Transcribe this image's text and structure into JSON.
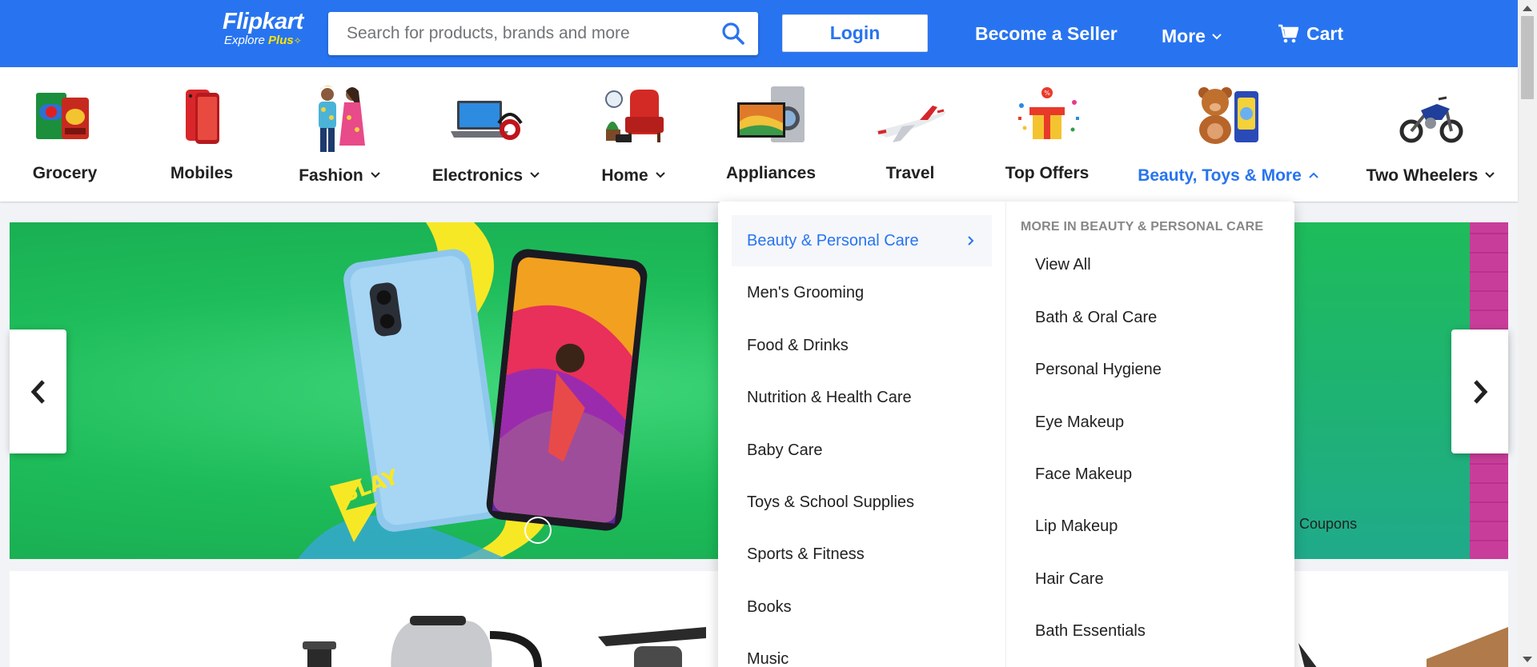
{
  "colors": {
    "brand": "#2874f0",
    "accent_yellow": "#ffe500",
    "banner_green": "#1ebc5a"
  },
  "header": {
    "logo_main": "Flipkart",
    "logo_sub_text": "Explore",
    "logo_sub_plus": "Plus",
    "search_placeholder": "Search for products, brands and more",
    "search_icon": "search-icon",
    "login_label": "Login",
    "seller_label": "Become a Seller",
    "more_label": "More",
    "cart_label": "Cart"
  },
  "categories": [
    {
      "label": "Grocery",
      "icon": "grocery-icon"
    },
    {
      "label": "Mobiles",
      "icon": "mobile-phone-icon"
    },
    {
      "label": "Fashion",
      "icon": "fashion-icon"
    },
    {
      "label": "Electronics",
      "icon": "laptop-icon"
    },
    {
      "label": "Home",
      "icon": "home-furniture-icon"
    },
    {
      "label": "Appliances",
      "icon": "appliances-icon"
    },
    {
      "label": "Travel",
      "icon": "airplane-icon"
    },
    {
      "label": "Top Offers",
      "icon": "gift-icon"
    },
    {
      "label": "Beauty, Toys & More",
      "icon": "teddy-bear-icon"
    },
    {
      "label": "Two Wheelers",
      "icon": "motorbike-icon"
    }
  ],
  "banner": {
    "coupons_text": "on Coupons"
  },
  "dropdown": {
    "left_items": [
      "Beauty & Personal Care",
      "Men's Grooming",
      "Food & Drinks",
      "Nutrition & Health Care",
      "Baby Care",
      "Toys & School Supplies",
      "Sports & Fitness",
      "Books",
      "Music"
    ],
    "active_item": "Beauty & Personal Care",
    "right_heading": "MORE IN BEAUTY & PERSONAL CARE",
    "right_items": [
      "View All",
      "Bath & Oral Care",
      "Personal Hygiene",
      "Eye Makeup",
      "Face Makeup",
      "Lip Makeup",
      "Hair Care",
      "Bath Essentials"
    ]
  }
}
